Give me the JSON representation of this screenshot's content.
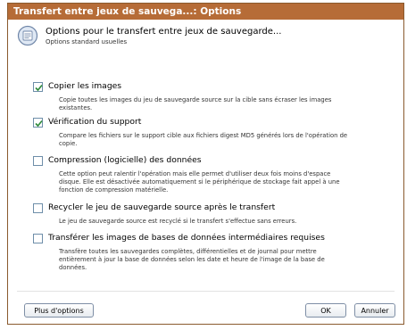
{
  "window": {
    "title": "Transfert entre jeux de sauvega...: Options"
  },
  "header": {
    "title": "Options pour le transfert entre jeux de sauvegarde...",
    "subtitle": "Options standard usuelles",
    "icon": "options-dialog-icon"
  },
  "options": [
    {
      "label": "Copier les images",
      "checked": true,
      "description": "Copie toutes les images du jeu de sauvegarde source sur la cible sans écraser les images existantes."
    },
    {
      "label": "Vérification du support",
      "checked": true,
      "description": "Compare les fichiers sur le support cible aux fichiers digest MD5 générés lors de l'opération de copie."
    },
    {
      "label": "Compression (logicielle) des données",
      "checked": false,
      "description": "Cette option peut ralentir l'opération mais elle permet d'utiliser deux fois moins d'espace disque. Elle est désactivée automatiquement si le périphérique de stockage fait appel à une fonction de compression matérielle."
    },
    {
      "label": "Recycler le jeu de sauvegarde source après le transfert",
      "checked": false,
      "description": "Le jeu de sauvegarde source est recyclé si le transfert s'effectue sans erreurs."
    },
    {
      "label": "Transférer les images de bases de données intermédiaires requises",
      "checked": false,
      "description": "Transfère toutes les sauvegardes complètes, différentielles et de journal pour mettre entièrement à jour la base de données selon les date et heure de l'image de la base de données."
    }
  ],
  "footer": {
    "more_options_label": "Plus d'options",
    "ok_label": "OK",
    "cancel_label": "Annuler"
  },
  "colors": {
    "titlebar": "#b66c37",
    "checkmark": "#2e8b3a"
  }
}
